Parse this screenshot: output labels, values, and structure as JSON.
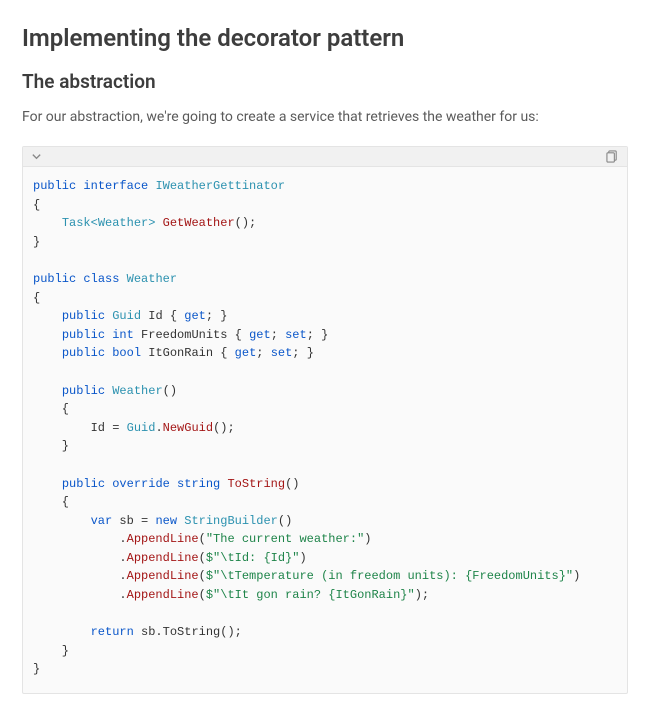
{
  "heading": "Implementing the decorator pattern",
  "subheading": "The abstraction",
  "intro": "For our abstraction, we're going to create a service that retrieves the weather for us:",
  "code": {
    "kw_public": "public",
    "kw_interface": "interface",
    "kw_class": "class",
    "kw_int": "int",
    "kw_bool": "bool",
    "kw_get": "get",
    "kw_set": "set",
    "kw_new": "new",
    "kw_override": "override",
    "kw_string": "string",
    "kw_var": "var",
    "kw_return": "return",
    "ty_IWeatherGettinator": "IWeatherGettinator",
    "ty_TaskWeather": "Task<Weather>",
    "ty_Weather": "Weather",
    "ty_Guid": "Guid",
    "ty_StringBuilder": "StringBuilder",
    "m_GetWeather": "GetWeather",
    "m_ToString": "ToString",
    "m_NewGuid": "NewGuid",
    "m_AppendLine": "AppendLine",
    "id_Id": "Id",
    "id_FreedomUnits": "FreedomUnits",
    "id_ItGonRain": "ItGonRain",
    "id_sb": "sb",
    "str1": "\"The current weather:\"",
    "str2": "$\"\\tId: {Id}\"",
    "str3": "$\"\\tTemperature (in freedom units): {FreedomUnits}\"",
    "str4": "$\"\\tIt gon rain? {ItGonRain}\"",
    "ret_expr": "sb.ToString();"
  }
}
